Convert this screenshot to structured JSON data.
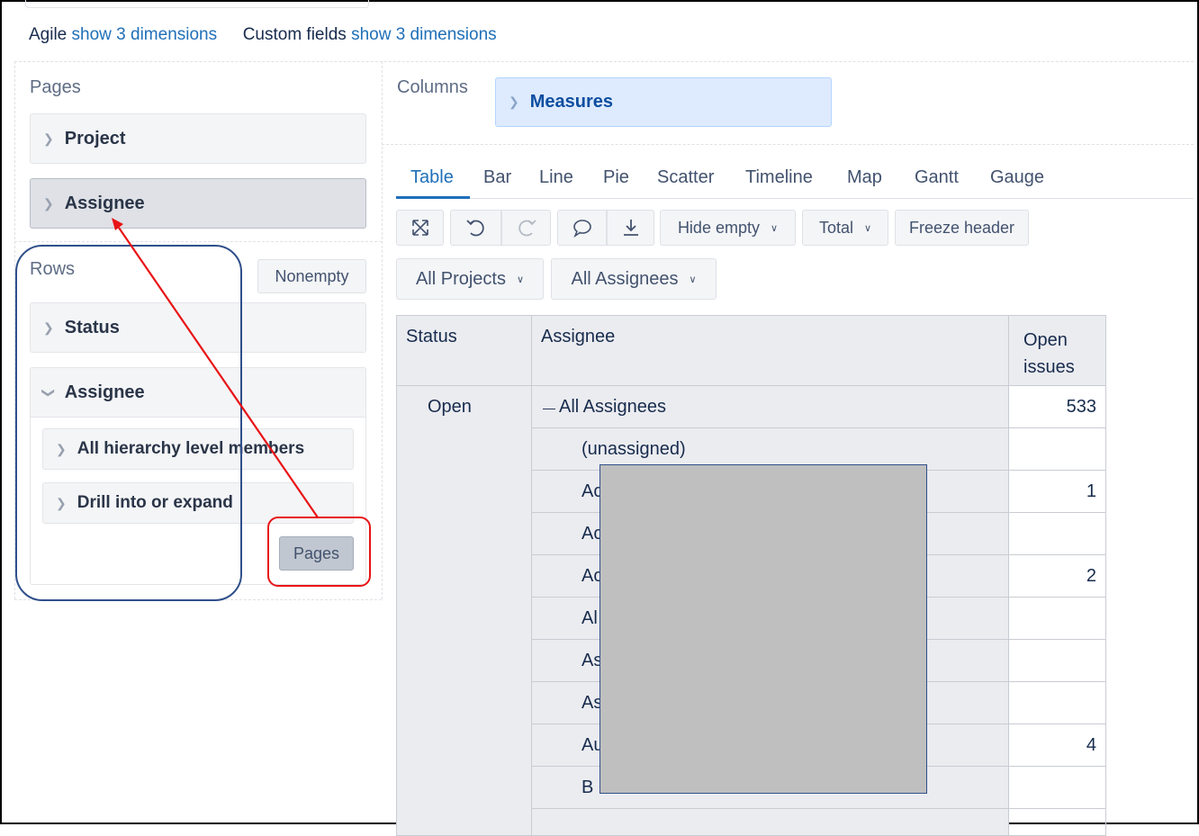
{
  "dimensions_bar": {
    "agile_label": "Agile",
    "agile_link": "show 3 dimensions",
    "custom_label": "Custom fields",
    "custom_link": "show 3 dimensions"
  },
  "pages": {
    "title": "Pages",
    "items": [
      "Project",
      "Assignee"
    ]
  },
  "columns": {
    "title": "Columns",
    "item": "Measures"
  },
  "rows": {
    "title": "Rows",
    "nonempty_label": "Nonempty",
    "status_item": "Status",
    "assignee_item": "Assignee",
    "submenu": [
      "All hierarchy level members",
      "Drill into or expand"
    ],
    "pages_button": "Pages"
  },
  "tabs": [
    "Table",
    "Bar",
    "Line",
    "Pie",
    "Scatter",
    "Timeline",
    "Map",
    "Gantt",
    "Gauge"
  ],
  "toolbar": {
    "hide_empty": "Hide empty",
    "total": "Total",
    "freeze_header": "Freeze header"
  },
  "filters": {
    "projects": "All Projects",
    "assignees": "All Assignees"
  },
  "table": {
    "headers": [
      "Status",
      "Assignee",
      "Open issues"
    ],
    "status_value": "Open",
    "rows": [
      {
        "assignee": "All Assignees",
        "value": "533"
      },
      {
        "assignee": "(unassigned)",
        "value": ""
      },
      {
        "assignee": "Ac",
        "value": "1"
      },
      {
        "assignee": "Ac",
        "value": ""
      },
      {
        "assignee": "Ac",
        "value": "2"
      },
      {
        "assignee": "Al",
        "value": ""
      },
      {
        "assignee": "As",
        "value": ""
      },
      {
        "assignee": "As",
        "value": ""
      },
      {
        "assignee": "Au",
        "value": "4"
      },
      {
        "assignee": "B",
        "value": ""
      }
    ]
  },
  "colors": {
    "link": "#1f6fb8",
    "annotation_red": "#e81416",
    "annotation_blue": "#2f4f8a",
    "redaction": "#bfbfbf"
  }
}
